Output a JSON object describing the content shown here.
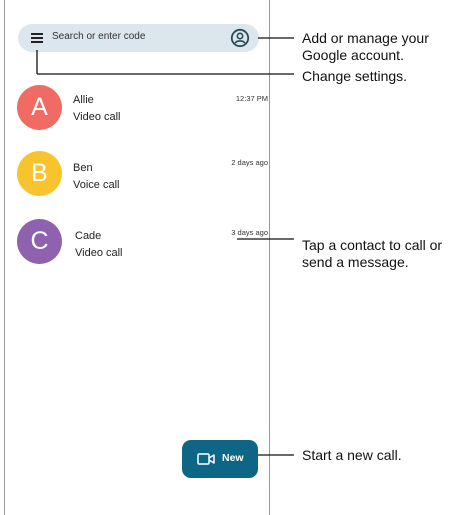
{
  "search": {
    "placeholder": "Search or enter code"
  },
  "contacts": [
    {
      "initial": "A",
      "name": "Allie",
      "type": "Video call",
      "time": "12:37 PM",
      "color": "#ef6b63"
    },
    {
      "initial": "B",
      "name": "Ben",
      "type": "Voice call",
      "time": "2 days ago",
      "color": "#f8c42d"
    },
    {
      "initial": "C",
      "name": "Cade",
      "type": "Video call",
      "time": "3 days ago",
      "color": "#8f62b0"
    }
  ],
  "fab": {
    "label": "New",
    "color": "#0d6686"
  },
  "callouts": {
    "account": "Add or manage your Google account.",
    "settings": "Change settings.",
    "contact": "Tap a contact to call or send a message.",
    "new_call": "Start a new call."
  },
  "icons": {
    "menu": "hamburger-menu-icon",
    "account": "account-circle-icon",
    "video": "video-camera-icon"
  }
}
